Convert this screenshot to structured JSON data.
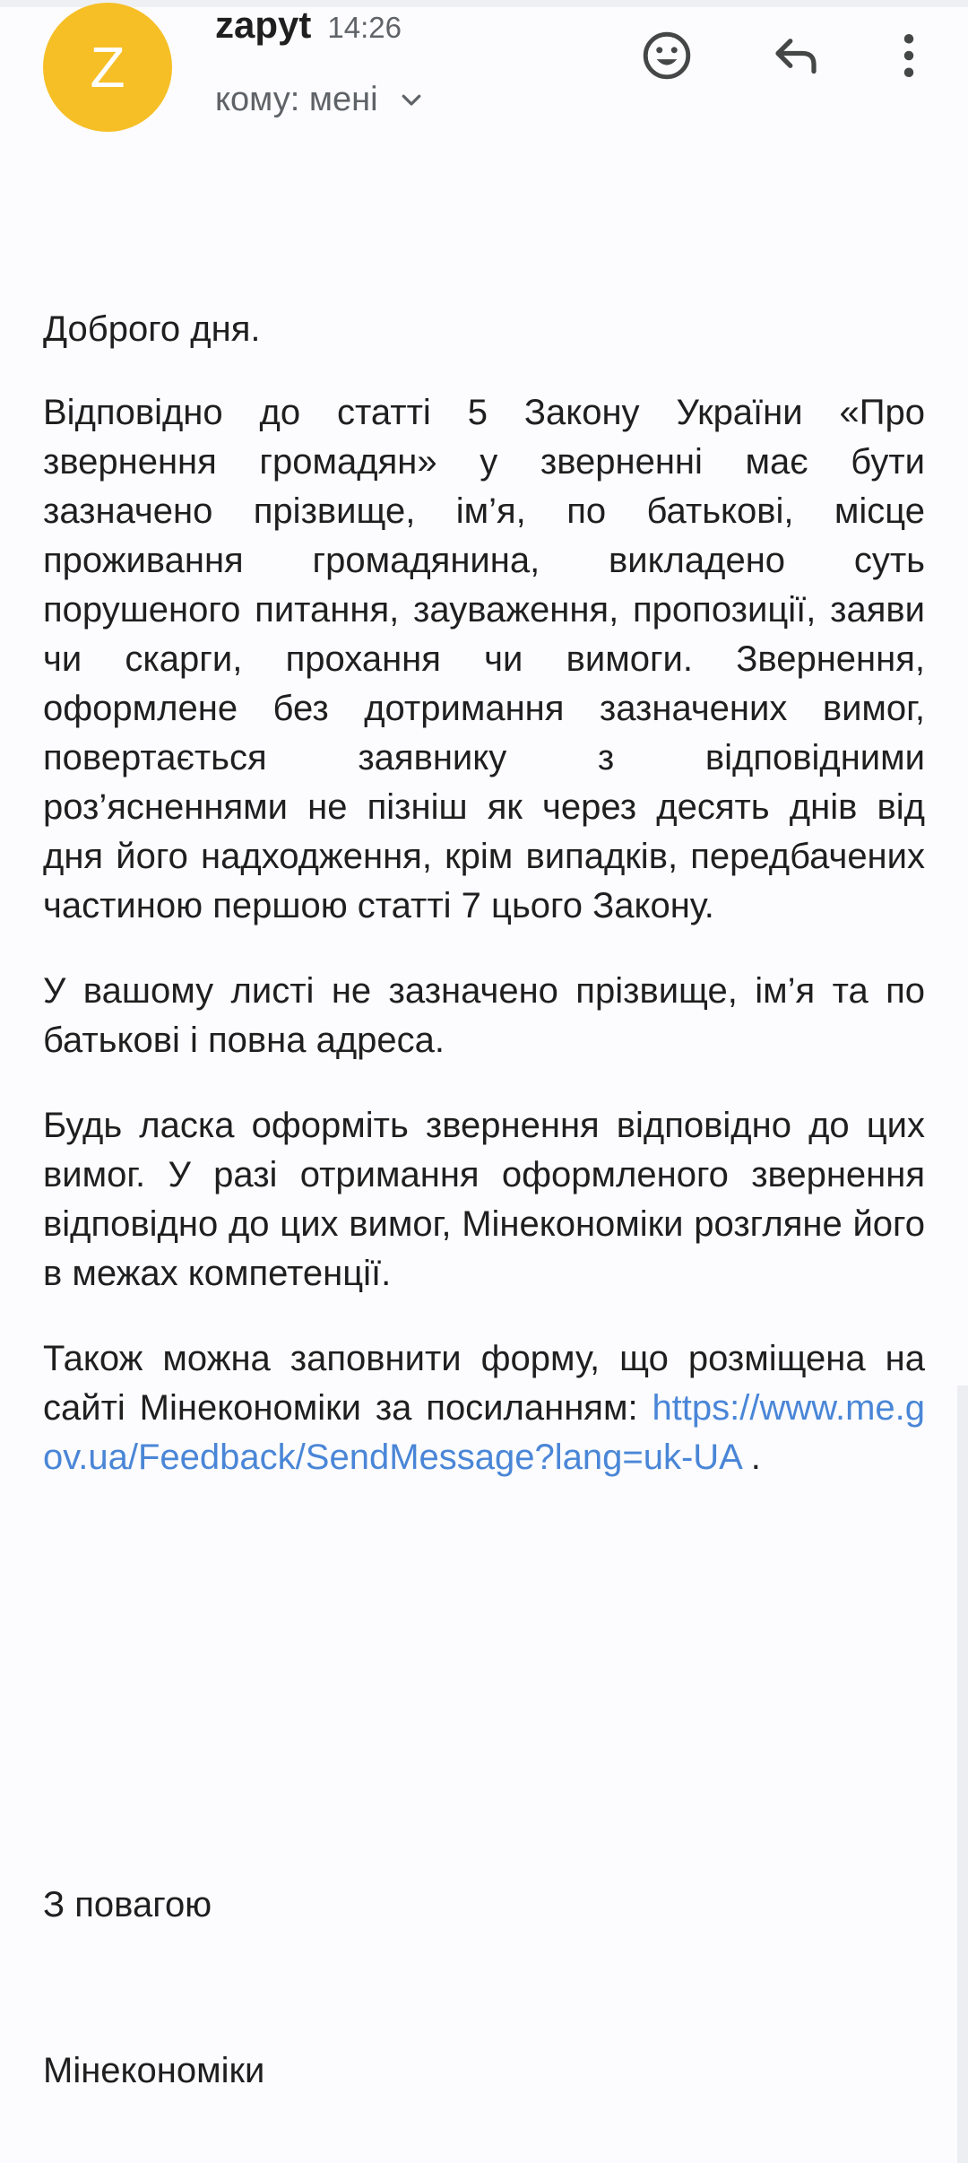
{
  "header": {
    "avatar_letter": "Z",
    "sender": "zapyt",
    "time": "14:26",
    "recipient": "кому: мені"
  },
  "colors": {
    "avatar": "#f6bf26",
    "link": "#4a86d7",
    "text": "#1f1f1f",
    "muted": "#5f6368"
  },
  "icons": {
    "emoji": "smile-face-icon",
    "reply": "reply-arrow-icon",
    "more": "more-vertical-icon",
    "expand": "chevron-down-icon"
  },
  "body": {
    "greeting": "Доброго дня.",
    "p1": "Відповідно до статті 5 Закону України «Про звернення громадян» у зверненні має бути зазначено прізвище, ім’я, по батькові, місце проживання громадянина, викладено суть порушеного питання, зауваження, пропозиції, заяви чи скарги, прохання чи вимоги. Звернення, оформлене без дотримання зазначених вимог, повертається заявнику з відповідними роз’ясненнями не пізніш як через десять днів від дня його надходження, крім випадків, передбачених частиною першою статті 7 цього Закону.",
    "p2": "У вашому листі не зазначено прізвище, ім’я та по батькові і повна адреса.",
    "p3": "Будь ласка оформіть звернення відповідно до цих вимог. У разі отримання оформленого звернення відповідно до цих вимог,  Мінекономіки розгляне його в межах компетенції.",
    "p4_text": "Також можна заповнити форму, що розміщена на сайті Мінекономіки за посиланням: ",
    "p4_link": "https://www.me.gov.ua/Feedback/SendMessage?lang=uk-UA",
    "p4_end": " .",
    "sign_off": "З повагою",
    "signature": "Мінекономіки"
  }
}
